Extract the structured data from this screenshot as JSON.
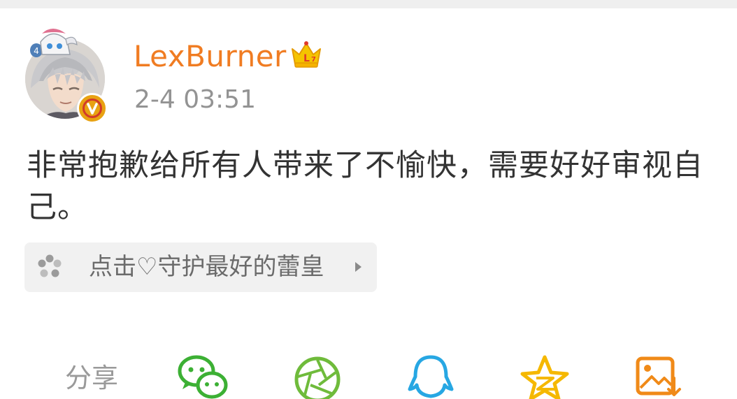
{
  "post": {
    "username": "LexBurner",
    "timestamp": "2-4 03:51",
    "text": "非常抱歉给所有人带来了不愉快，需要好好审视自己。"
  },
  "super_topic": {
    "label": "点击♡守护最好的蕾皇",
    "icon": "supertopic-flower-icon"
  },
  "share": {
    "label": "分享",
    "targets": [
      {
        "name": "wechat",
        "icon": "wechat-icon",
        "color": "#3cb034"
      },
      {
        "name": "moments",
        "icon": "moments-icon",
        "color": "#6fbb3b"
      },
      {
        "name": "qq",
        "icon": "qq-icon",
        "color": "#27a7e3"
      },
      {
        "name": "qzone",
        "icon": "qzone-star-icon",
        "color": "#f5b800"
      },
      {
        "name": "save-image",
        "icon": "save-image-icon",
        "color": "#f08a18"
      }
    ]
  },
  "colors": {
    "username": "#f07c22",
    "verified_badge": "#e8a212",
    "timestamp": "#939393",
    "body_text": "#333333"
  }
}
